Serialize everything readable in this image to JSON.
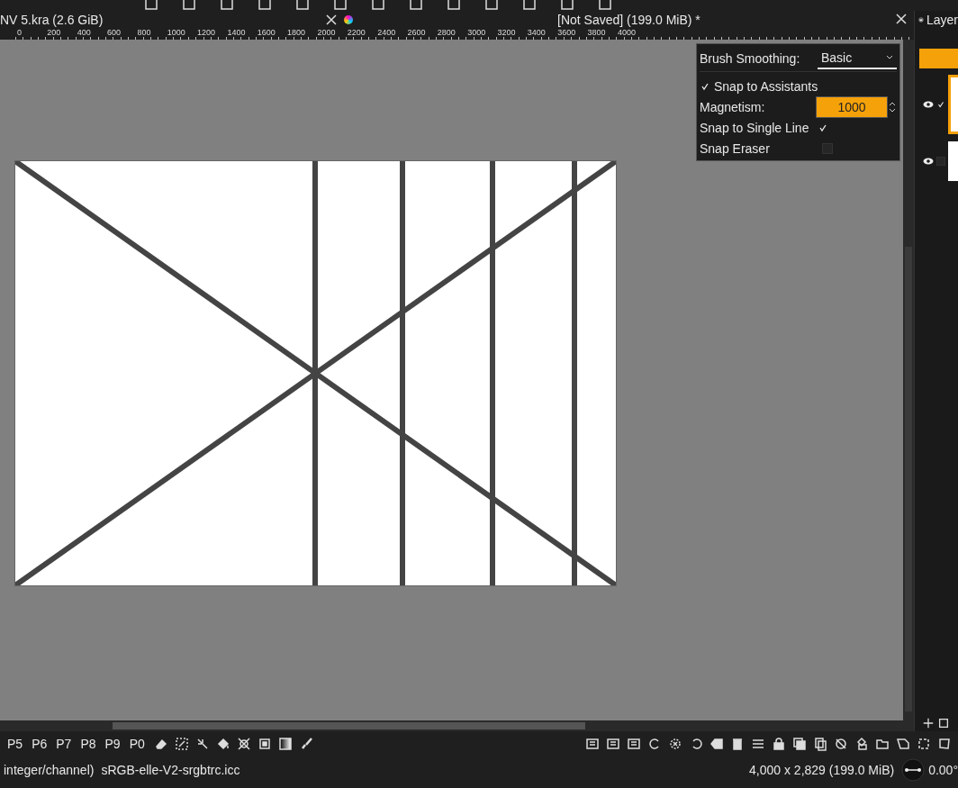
{
  "view_tabs": [
    {
      "title": "NV 5.kra (2.6 GiB)"
    },
    {
      "title": "[Not Saved]  (199.0 MiB) *"
    }
  ],
  "ruler": {
    "labels": [
      "0",
      "200",
      "400",
      "600",
      "800",
      "1000",
      "1200",
      "1400",
      "1600",
      "1800",
      "2000",
      "2200",
      "2400",
      "2600",
      "2800",
      "3000",
      "3200",
      "3400",
      "3600",
      "3800",
      "4000"
    ]
  },
  "tool_options": {
    "brush_smoothing": {
      "label": "Brush Smoothing:",
      "value": "Basic"
    },
    "snap_to_assistants": {
      "label": "Snap to Assistants",
      "checked": true
    },
    "magnetism": {
      "label": "Magnetism:",
      "value": "1000"
    },
    "snap_to_single_line": {
      "label": "Snap to Single Line",
      "checked": true
    },
    "snap_eraser": {
      "label": "Snap Eraser",
      "checked": false
    }
  },
  "layers_docker": {
    "title": "Layer",
    "layers": [
      {
        "selected": true,
        "checked": true
      },
      {
        "selected": false,
        "checked": false
      }
    ]
  },
  "presets": [
    "P5",
    "P6",
    "P7",
    "P8",
    "P9",
    "P0"
  ],
  "status_bar": {
    "color_info": "integer/channel)",
    "profile": "sRGB-elle-V2-srgbtrc.icc",
    "dimensions": "4,000 x 2,829 (199.0 MiB)",
    "rotation": "0.00°"
  }
}
